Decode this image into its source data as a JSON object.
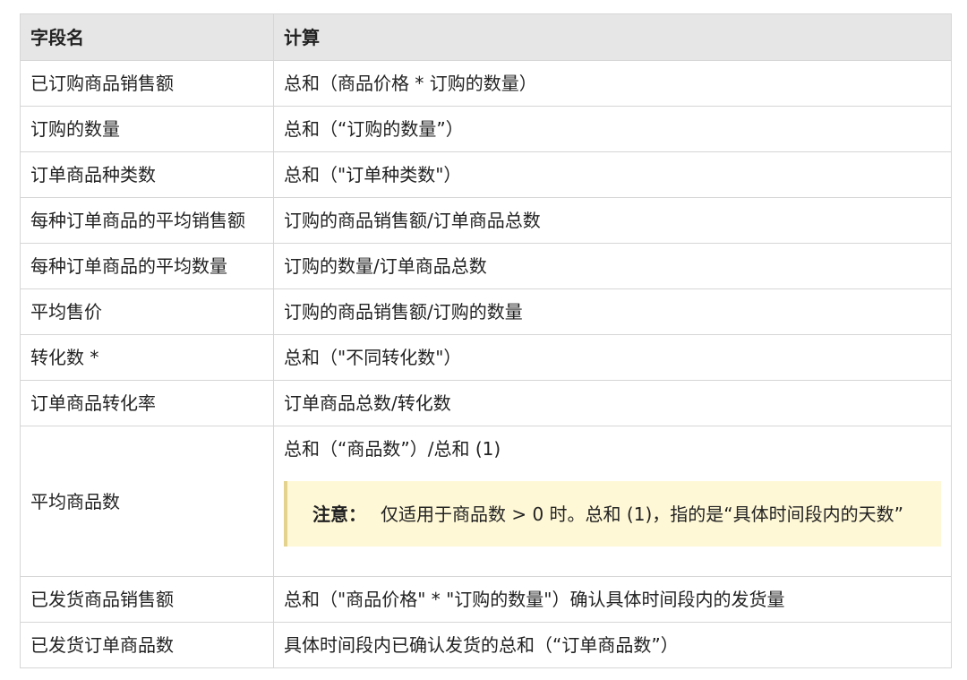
{
  "table": {
    "headers": [
      "字段名",
      "计算"
    ],
    "rows": [
      {
        "field": "已订购商品销售额",
        "calc": "总和（商品价格 * 订购的数量）"
      },
      {
        "field": "订购的数量",
        "calc": "总和（“订购的数量”）"
      },
      {
        "field": "订单商品种类数",
        "calc": "总和（\"订单种类数\"）"
      },
      {
        "field": "每种订单商品的平均销售额",
        "calc": "订购的商品销售额/订单商品总数"
      },
      {
        "field": "每种订单商品的平均数量",
        "calc": "订购的数量/订单商品总数"
      },
      {
        "field": "平均售价",
        "calc": "订购的商品销售额/订购的数量"
      },
      {
        "field": "转化数 *",
        "calc": "总和（\"不同转化数\"）"
      },
      {
        "field": "订单商品转化率",
        "calc": "订单商品总数/转化数"
      },
      {
        "field": "平均商品数",
        "calc": "总和（“商品数”）/总和 (1)",
        "note_label": "注意：",
        "note_text": "仅适用于商品数 > 0 时。总和 (1)，指的是“具体时间段内的天数”"
      },
      {
        "field": "已发货商品销售额",
        "calc": "总和（\"商品价格\" * \"订购的数量\"）确认具体时间段内的发货量"
      },
      {
        "field": "已发货订单商品数",
        "calc": "具体时间段内已确认发货的总和（“订单商品数”）"
      }
    ]
  },
  "colors": {
    "header_bg": "#e6e6e6",
    "border": "#d6d6d6",
    "note_bg": "#fff8d6",
    "note_border": "#e3d38e"
  }
}
